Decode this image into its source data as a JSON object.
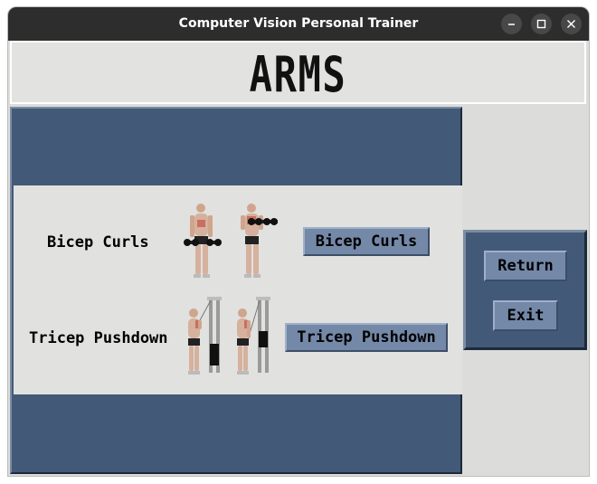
{
  "window": {
    "title": "Computer Vision Personal Trainer"
  },
  "header": {
    "title": "ARMS"
  },
  "exercises": [
    {
      "label": "Bicep Curls",
      "button_label": "Bicep Curls"
    },
    {
      "label": "Tricep Pushdown",
      "button_label": "Tricep Pushdown"
    }
  ],
  "nav": {
    "return_label": "Return",
    "exit_label": "Exit"
  },
  "colors": {
    "panel": "#425a78",
    "button": "#7488a8",
    "background": "#dcdcda",
    "titlebar": "#2d2d2d"
  },
  "icons": {
    "minimize": "minimize-icon",
    "maximize": "maximize-icon",
    "close": "close-icon"
  }
}
